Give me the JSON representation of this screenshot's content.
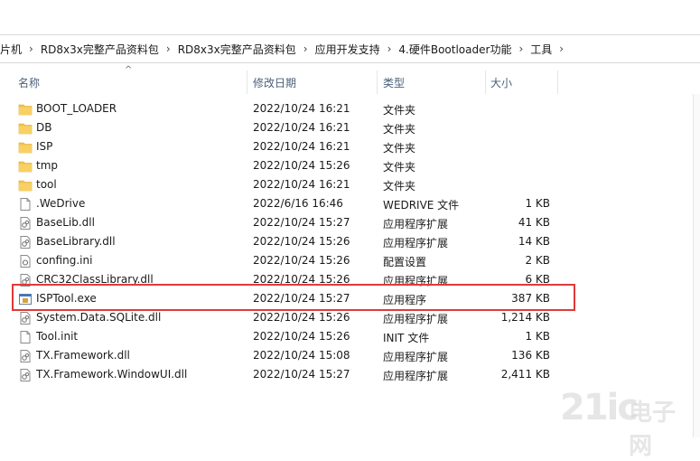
{
  "breadcrumb": [
    "单片机",
    "RD8x3x完整产品资料包",
    "RD8x3x完整产品资料包",
    "应用开发支持",
    "4.硬件Bootloader功能",
    "工具"
  ],
  "columns": {
    "name": "名称",
    "date": "修改日期",
    "type": "类型",
    "size": "大小"
  },
  "files": [
    {
      "name": "BOOT_LOADER",
      "date": "2022/10/24 16:21",
      "type": "文件夹",
      "size": "",
      "icon": "folder-icon"
    },
    {
      "name": "DB",
      "date": "2022/10/24 16:21",
      "type": "文件夹",
      "size": "",
      "icon": "folder-icon"
    },
    {
      "name": "ISP",
      "date": "2022/10/24 16:21",
      "type": "文件夹",
      "size": "",
      "icon": "folder-icon"
    },
    {
      "name": "tmp",
      "date": "2022/10/24 15:26",
      "type": "文件夹",
      "size": "",
      "icon": "folder-icon"
    },
    {
      "name": "tool",
      "date": "2022/10/24 16:21",
      "type": "文件夹",
      "size": "",
      "icon": "folder-icon"
    },
    {
      "name": ".WeDrive",
      "date": "2022/6/16 16:46",
      "type": "WEDRIVE 文件",
      "size": "1 KB",
      "icon": "file-icon"
    },
    {
      "name": "BaseLib.dll",
      "date": "2022/10/24 15:27",
      "type": "应用程序扩展",
      "size": "41 KB",
      "icon": "dll-icon"
    },
    {
      "name": "BaseLibrary.dll",
      "date": "2022/10/24 15:26",
      "type": "应用程序扩展",
      "size": "14 KB",
      "icon": "dll-icon"
    },
    {
      "name": "confing.ini",
      "date": "2022/10/24 15:26",
      "type": "配置设置",
      "size": "2 KB",
      "icon": "ini-icon"
    },
    {
      "name": "CRC32ClassLibrary.dll",
      "date": "2022/10/24 15:26",
      "type": "应用程序扩展",
      "size": "6 KB",
      "icon": "dll-icon"
    },
    {
      "name": "ISPTool.exe",
      "date": "2022/10/24 15:27",
      "type": "应用程序",
      "size": "387 KB",
      "icon": "exe-icon"
    },
    {
      "name": "System.Data.SQLite.dll",
      "date": "2022/10/24 15:26",
      "type": "应用程序扩展",
      "size": "1,214 KB",
      "icon": "dll-icon"
    },
    {
      "name": "Tool.init",
      "date": "2022/10/24 15:26",
      "type": "INIT 文件",
      "size": "1 KB",
      "icon": "file-icon"
    },
    {
      "name": "TX.Framework.dll",
      "date": "2022/10/24 15:08",
      "type": "应用程序扩展",
      "size": "136 KB",
      "icon": "dll-icon"
    },
    {
      "name": "TX.Framework.WindowUI.dll",
      "date": "2022/10/24 15:27",
      "type": "应用程序扩展",
      "size": "2,411 KB",
      "icon": "dll-icon"
    }
  ],
  "watermark": {
    "num": "21ic",
    "cn": "电子网"
  },
  "colors": {
    "highlight": "#e03a3a",
    "folder": "#f3c44a",
    "header_text": "#4c607a"
  }
}
